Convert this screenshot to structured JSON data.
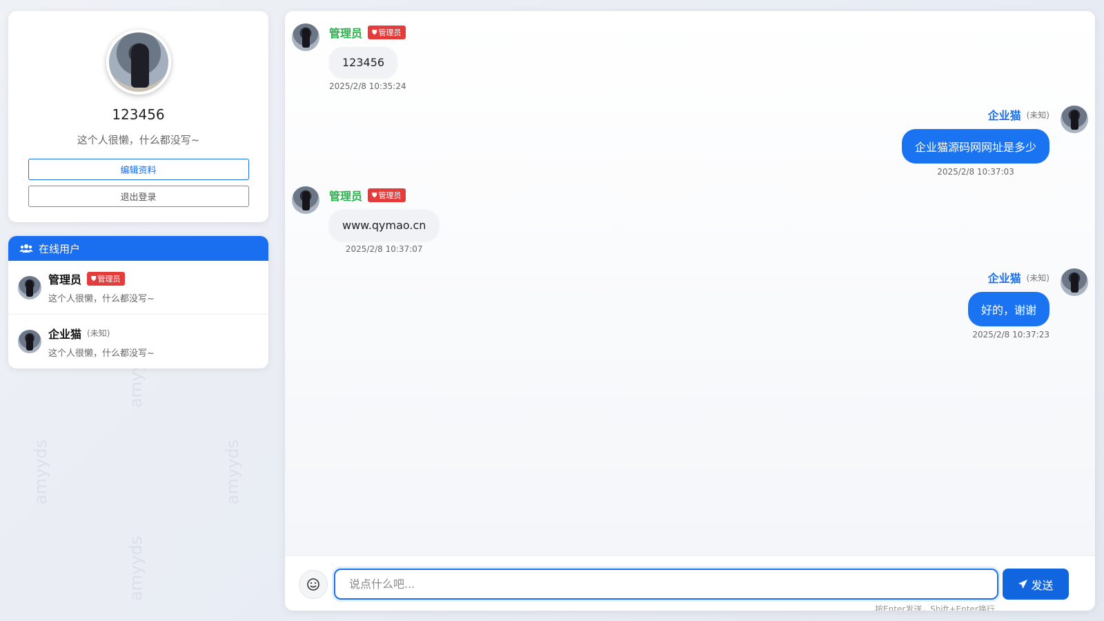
{
  "profile": {
    "name": "123456",
    "bio": "这个人很懒，什么都没写~",
    "edit_label": "编辑资料",
    "logout_label": "退出登录"
  },
  "online": {
    "title": "在线用户",
    "users": [
      {
        "name": "管理员",
        "badge": "管理员",
        "bio": "这个人很懒，什么都没写~"
      },
      {
        "name": "企业猫",
        "tag": "(未知)",
        "bio": "这个人很懒，什么都没写~"
      }
    ]
  },
  "messages": [
    {
      "side": "left",
      "sender": "管理员",
      "badge": "管理员",
      "text": "123456",
      "time": "2025/2/8 10:35:24"
    },
    {
      "side": "right",
      "sender": "企业猫",
      "tag": "(未知)",
      "text": "企业猫源码网网址是多少",
      "time": "2025/2/8 10:37:03"
    },
    {
      "side": "left",
      "sender": "管理员",
      "badge": "管理员",
      "text": "www.qymao.cn",
      "time": "2025/2/8 10:37:07"
    },
    {
      "side": "right",
      "sender": "企业猫",
      "tag": "(未知)",
      "text": "好的，谢谢",
      "time": "2025/2/8 10:37:23"
    }
  ],
  "composer": {
    "placeholder": "说点什么吧...",
    "send_label": "发送",
    "hint": "按Enter发送，Shift+Enter换行"
  },
  "watermark": "amyyds",
  "icons": {
    "users": "users-icon",
    "shield": "shield-icon",
    "emoji": "emoji-icon",
    "send": "paper-plane-icon"
  },
  "colors": {
    "primary": "#1a6ef0",
    "admin_name": "#2bb24c",
    "admin_badge": "#e43b3b",
    "bubble_out": "#1a73f0",
    "bubble_in": "#f1f2f5"
  }
}
